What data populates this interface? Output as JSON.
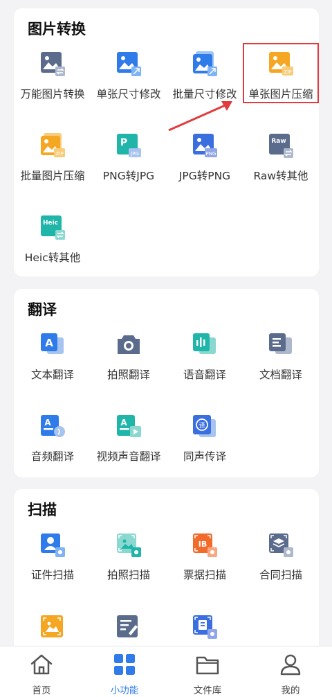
{
  "sections": [
    {
      "title": "图片转换",
      "items": [
        {
          "label": "万能图片转换",
          "icon": "image-convert-icon"
        },
        {
          "label": "单张尺寸修改",
          "icon": "image-resize-icon"
        },
        {
          "label": "批量尺寸修改",
          "icon": "batch-resize-icon"
        },
        {
          "label": "单张图片压缩",
          "icon": "image-compress-icon"
        },
        {
          "label": "批量图片压缩",
          "icon": "batch-compress-icon"
        },
        {
          "label": "PNG转JPG",
          "icon": "png-to-jpg-icon"
        },
        {
          "label": "JPG转PNG",
          "icon": "jpg-to-png-icon"
        },
        {
          "label": "Raw转其他",
          "icon": "raw-convert-icon"
        },
        {
          "label": "Heic转其他",
          "icon": "heic-convert-icon"
        }
      ]
    },
    {
      "title": "翻译",
      "items": [
        {
          "label": "文本翻译",
          "icon": "text-translate-icon"
        },
        {
          "label": "拍照翻译",
          "icon": "camera-icon"
        },
        {
          "label": "语音翻译",
          "icon": "voice-icon"
        },
        {
          "label": "文档翻译",
          "icon": "document-icon"
        },
        {
          "label": "音频翻译",
          "icon": "audio-translate-icon"
        },
        {
          "label": "视频声音翻译",
          "icon": "video-translate-icon"
        },
        {
          "label": "同声传译",
          "icon": "simultaneous-interpret-icon"
        }
      ]
    },
    {
      "title": "扫描",
      "items": [
        {
          "label": "证件扫描",
          "icon": "id-scan-icon"
        },
        {
          "label": "拍照扫描",
          "icon": "photo-scan-icon"
        },
        {
          "label": "票据扫描",
          "icon": "receipt-scan-icon"
        },
        {
          "label": "合同扫描",
          "icon": "contract-scan-icon"
        },
        {
          "label": "",
          "icon": "image-scan-icon"
        },
        {
          "label": "",
          "icon": "text-scan-icon"
        },
        {
          "label": "",
          "icon": "book-scan-icon"
        }
      ]
    }
  ],
  "icon_text": {
    "zip": "ZIP",
    "p": "P",
    "jpg": "JPG",
    "png": "PNG",
    "raw": "Raw",
    "heic": "Heic",
    "a": "A",
    "yi": "译",
    "ia": "IB"
  },
  "tabs": [
    {
      "label": "首页",
      "icon": "home-icon"
    },
    {
      "label": "小功能",
      "icon": "grid-icon",
      "active": true
    },
    {
      "label": "文件库",
      "icon": "folder-icon"
    },
    {
      "label": "我的",
      "icon": "user-icon"
    }
  ],
  "colors": {
    "accent": "#2f7bea",
    "highlight": "#e23b3b",
    "orange": "#f5a623",
    "teal": "#1fb5a8",
    "slate": "#5b6b8c"
  }
}
